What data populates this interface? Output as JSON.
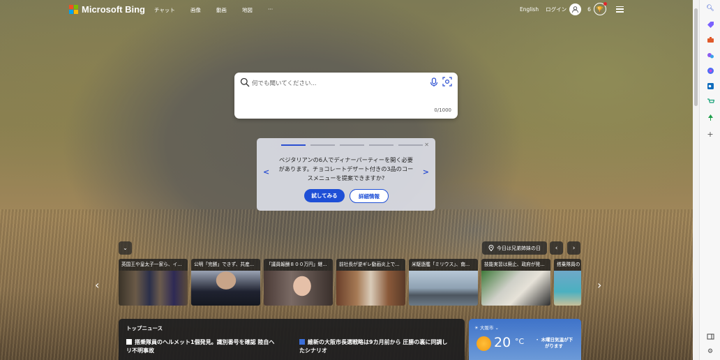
{
  "header": {
    "brand": "Microsoft Bing",
    "nav": [
      "チャット",
      "画像",
      "動画",
      "地図",
      "···"
    ],
    "language": "English",
    "login": "ログイン",
    "reward_count": "6"
  },
  "search": {
    "placeholder": "何でも聞いてください...",
    "counter": "0/1000"
  },
  "suggestion": {
    "text": "ベジタリアンの6人でディナーパーティーを開く必要があります。チョコレートデザート付きの3品のコースメニューを提案できますか?",
    "try_label": "試してみる",
    "details_label": "詳細情報"
  },
  "news_strip": {
    "today": "今日は兄弟姉妹の日",
    "tiles": [
      {
        "caption": "英国王や皇太子一家ら、イ..."
      },
      {
        "caption": "公明「完勝」できず、共産..."
      },
      {
        "caption": "「議員報酬８００万円」継..."
      },
      {
        "caption": "前社長が逆ギレ動画炎上で..."
      },
      {
        "caption": "米駆逐艦「ミリウス」、南..."
      },
      {
        "caption": "技能実習は廃止、政府が発..."
      },
      {
        "caption": "搭乗隊員の"
      }
    ]
  },
  "top_news": {
    "heading": "トップニュース",
    "items": [
      {
        "title": "搭乗隊員のヘルメット1個発見。識別番号を確認 陸自ヘリ不明事故"
      },
      {
        "title": "維新の大阪市長選戦略は9カ月前から 圧勝の裏に同調したシナリオ"
      }
    ]
  },
  "weather": {
    "city": "大阪市",
    "temperature": "20",
    "unit": "°C",
    "alert": "・ 木曜日気温が下がります"
  },
  "colors": {
    "accent": "#1e4fd6",
    "weather_bg": "#3f73c9"
  }
}
